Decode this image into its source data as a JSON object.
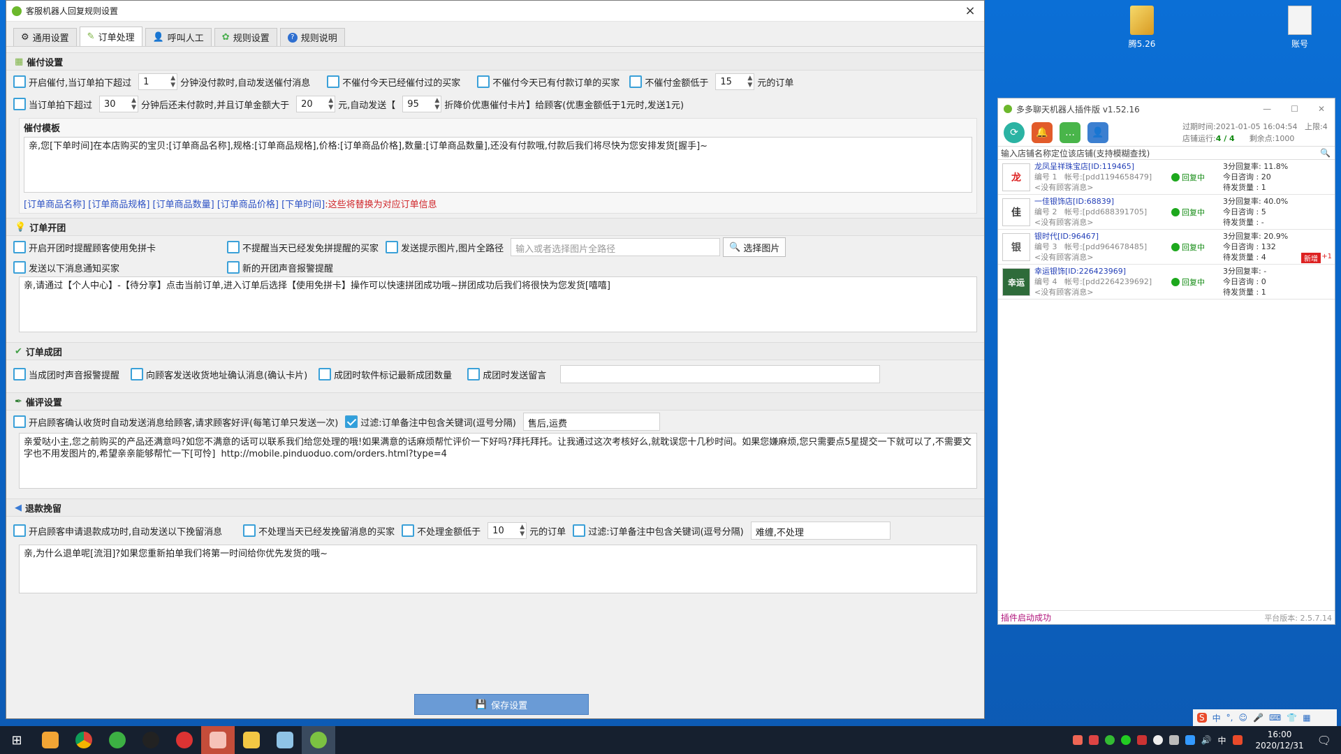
{
  "window": {
    "title": "客服机器人回复规则设置",
    "close": "×"
  },
  "tabs": [
    {
      "label": "通用设置",
      "icon": "gear-icon"
    },
    {
      "label": "订单处理",
      "icon": "pencil-icon"
    },
    {
      "label": "呼叫人工",
      "icon": "person-icon"
    },
    {
      "label": "规则设置",
      "icon": "cog-icon"
    },
    {
      "label": "规则说明",
      "icon": "help-icon"
    }
  ],
  "pay_reminder": {
    "title": "催付设置",
    "opt1": {
      "checked": false,
      "label": "开启催付,当订单拍下超过",
      "minutes": "1",
      "suffix": "分钟没付款时,自动发送催付消息"
    },
    "opt2": {
      "checked": false,
      "label": "不催付今天已经催付过的买家"
    },
    "opt3": {
      "checked": false,
      "label": "不催付今天已有付款订单的买家"
    },
    "opt4": {
      "checked": false,
      "label": "不催付金额低于",
      "amount": "15",
      "suffix": "元的订单"
    },
    "opt5": {
      "checked": false,
      "label": "当订单拍下超过",
      "minutes": "30",
      "mid": "分钟后还未付款时,并且订单金额大于",
      "amount": "20",
      "mid2": "元,自动发送【",
      "discount": "95",
      "suffix": "折降价优惠催付卡片】给顾客(优惠金额低于1元时,发送1元)"
    },
    "template_title": "催付模板",
    "template": "亲,您[下单时间]在本店购买的宝贝:[订单商品名称],规格:[订单商品规格],价格:[订单商品价格],数量:[订单商品数量],还没有付款哦,付款后我们将尽快为您安排发货[握手]~",
    "vars": "[订单商品名称] [订单商品规格] [订单商品数量] [订单商品价格] [下单时间]",
    "vars_note": ":这些将替换为对应订单信息"
  },
  "group_open": {
    "title": "订单开团",
    "opt1": {
      "checked": false,
      "label": "开启开团时提醒顾客使用免拼卡"
    },
    "opt2": {
      "checked": false,
      "label": "不提醒当天已经发免拼提醒的买家"
    },
    "opt3": {
      "checked": false,
      "label": "发送提示图片,图片全路径"
    },
    "path_placeholder": "输入或者选择图片全路径",
    "choose_btn": "选择图片",
    "opt4": {
      "checked": false,
      "label": "发送以下消息通知买家"
    },
    "opt5": {
      "checked": false,
      "label": "新的开团声音报警提醒"
    },
    "message": "亲,请通过【个人中心】-【待分享】点击当前订单,进入订单后选择【使用免拼卡】操作可以快速拼团成功哦~拼团成功后我们将很快为您发货[嘻嘻]"
  },
  "group_done": {
    "title": "订单成团",
    "opt1": {
      "checked": false,
      "label": "当成团时声音报警提醒"
    },
    "opt2": {
      "checked": false,
      "label": "向顾客发送收货地址确认消息(确认卡片)"
    },
    "opt3": {
      "checked": false,
      "label": "成团时软件标记最新成团数量"
    },
    "opt4": {
      "checked": false,
      "label": "成团时发送留言"
    },
    "message": ""
  },
  "review": {
    "title": "催评设置",
    "opt1": {
      "checked": false,
      "label": "开启顾客确认收货时自动发送消息给顾客,请求顾客好评(每笔订单只发送一次)"
    },
    "opt2": {
      "checked": true,
      "label": "过滤:订单备注中包含关键词(逗号分隔)"
    },
    "keywords": "售后,运费",
    "message": "亲爱哒小主,您之前购买的产品还满意吗?如您不满意的话可以联系我们给您处理的哦!如果满意的话麻烦帮忙评价一下好吗?拜托拜托。让我通过这次考核好么,就耽误您十几秒时间。如果您嫌麻烦,您只需要点5星提交一下就可以了,不需要文字也不用发图片的,希望亲亲能够帮忙一下[可怜]  http://mobile.pinduoduo.com/orders.html?type=4"
  },
  "refund": {
    "title": "退款挽留",
    "opt1": {
      "checked": false,
      "label": "开启顾客申请退款成功时,自动发送以下挽留消息"
    },
    "opt2": {
      "checked": false,
      "label": "不处理当天已经发挽留消息的买家"
    },
    "opt3": {
      "checked": false,
      "label": "不处理金额低于",
      "amount": "10",
      "suffix": "元的订单"
    },
    "opt4": {
      "checked": false,
      "label": "过滤:订单备注中包含关键词(逗号分隔)"
    },
    "keywords": "难缠,不处理",
    "message": "亲,为什么退单呢[流泪]?如果您重新拍单我们将第一时间给你优先发货的哦~"
  },
  "save_btn": "保存设置",
  "plugin": {
    "title": "多多聊天机器人插件版 v1.52.16",
    "expiry": "过期时间:2021-01-05 16:04:54",
    "limit": "上限:4",
    "running_label": "店铺运行:",
    "running": "4 / 4",
    "balance": "剩余点:1000",
    "search_placeholder": "输入店铺名称定位该店铺(支持模糊查找)",
    "shops": [
      {
        "name": "龙凤呈祥珠宝店[ID:119465]",
        "no": "编号 1",
        "acct": "帐号:[pdd1194658479]",
        "note": "<没有顾客消息>",
        "status": "回复中",
        "rate": "3分回复率: 11.8%",
        "today": "今日咨询 : 20",
        "pending": "待发货量 : 1",
        "logo": "龙",
        "badge": "",
        "plus": ""
      },
      {
        "name": "一佳银饰店[ID:68839]",
        "no": "编号 2",
        "acct": "帐号:[pdd688391705]",
        "note": "<没有顾客消息>",
        "status": "回复中",
        "rate": "3分回复率: 40.0%",
        "today": "今日咨询 : 5",
        "pending": "待发货量 : -",
        "logo": "佳",
        "badge": "",
        "plus": ""
      },
      {
        "name": "银时代[ID:96467]",
        "no": "编号 3",
        "acct": "帐号:[pdd964678485]",
        "note": "<没有顾客消息>",
        "status": "回复中",
        "rate": "3分回复率: 20.9%",
        "today": "今日咨询 : 132",
        "pending": "待发货量 : 4",
        "logo": "银",
        "badge": "新增",
        "plus": "+1"
      },
      {
        "name": "幸运银饰[ID:226423969]",
        "no": "编号 4",
        "acct": "帐号:[pdd2264239692]",
        "note": "<没有顾客消息>",
        "status": "回复中",
        "rate": "3分回复率: -",
        "today": "今日咨询 : 0",
        "pending": "待发货量 : 1",
        "logo": "幸运",
        "badge": "",
        "plus": ""
      }
    ],
    "footer_status": "插件启动成功",
    "footer_version": "平台版本: 2.5.7.14"
  },
  "desktop": {
    "icon1": "腾5.26",
    "icon2": "账号"
  },
  "taskbar": {
    "ime1": "中",
    "clock_time": "16:00",
    "clock_date": "2020/12/31",
    "lang": "中"
  },
  "colors": {
    "accent": "#2f9fdc",
    "link": "#2d52c4",
    "warn": "#d0262a",
    "online": "#1da81d"
  }
}
